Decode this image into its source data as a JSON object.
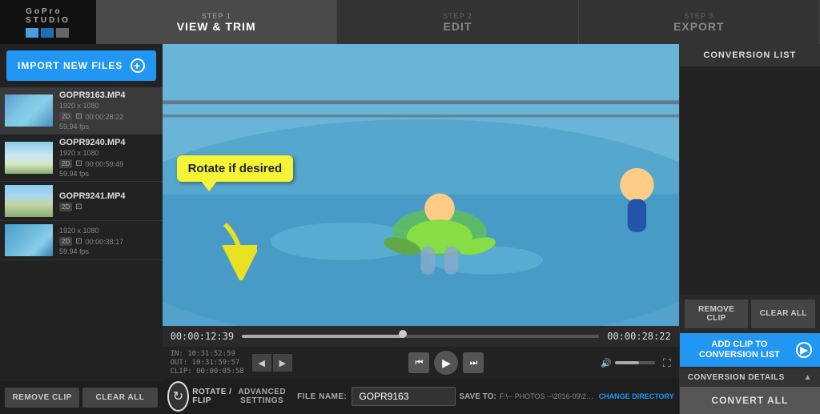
{
  "header": {
    "logo": {
      "brand": "GoPro",
      "product": "STUDIO"
    },
    "steps": [
      {
        "num": "STEP 1",
        "label": "VIEW & TRIM",
        "active": true
      },
      {
        "num": "STEP 2",
        "label": "EDIT",
        "active": false
      },
      {
        "num": "STEP 3",
        "label": "EXPORT",
        "active": false
      }
    ]
  },
  "left_panel": {
    "import_button": "IMPORT NEW FILES",
    "files": [
      {
        "name": "GOPR9163.MP4",
        "resolution": "1920 x 1080",
        "duration": "00:00:28:22",
        "fps": "59.94 fps",
        "type": "2D"
      },
      {
        "name": "GOPR9240.MP4",
        "resolution": "1920 x 1080",
        "duration": "00:00:59:49",
        "fps": "59.94 fps",
        "type": "2D"
      },
      {
        "name": "GOPR9241.MP4",
        "resolution": "",
        "duration": "",
        "fps": "",
        "type": "2D"
      },
      {
        "name": "",
        "resolution": "1920 x 1080",
        "duration": "00:00:38:17",
        "fps": "59.94 fps",
        "type": "2D"
      }
    ],
    "remove_clip": "REMOVE CLIP",
    "clear_all": "CLEAR ALL"
  },
  "video": {
    "current_time": "00:00:12:39",
    "end_time": "00:00:28:22",
    "in_point": "IN: 10:31:52:59",
    "out_point": "OUT: 10:31:59:57",
    "clip_duration": "CLIP: 00:00:05:58"
  },
  "tooltip": {
    "text": "Rotate if desired"
  },
  "bottom_controls": {
    "rotate_flip": "ROTATE / FLIP",
    "advanced_settings": "ADVANCED SETTINGS",
    "file_name_label": "FILE NAME:",
    "file_name_value": "GOPR9163",
    "save_to_label": "SAVE TO:",
    "save_path": "F:\\-- PHOTOS --\\2016-09\\2016-...",
    "change_directory": "CHANGE DIRECTORY"
  },
  "right_panel": {
    "conversion_list_header": "CONVERSION LIST",
    "remove_clip": "REMOVE CLIP",
    "clear_all": "CLEAR ALL",
    "conversion_details": "CONVERSION DETAILS",
    "add_clip_line1": "ADD CLIP TO",
    "add_clip_line2": "CONVERSION LIST",
    "convert_all": "CONVERT ALL"
  }
}
